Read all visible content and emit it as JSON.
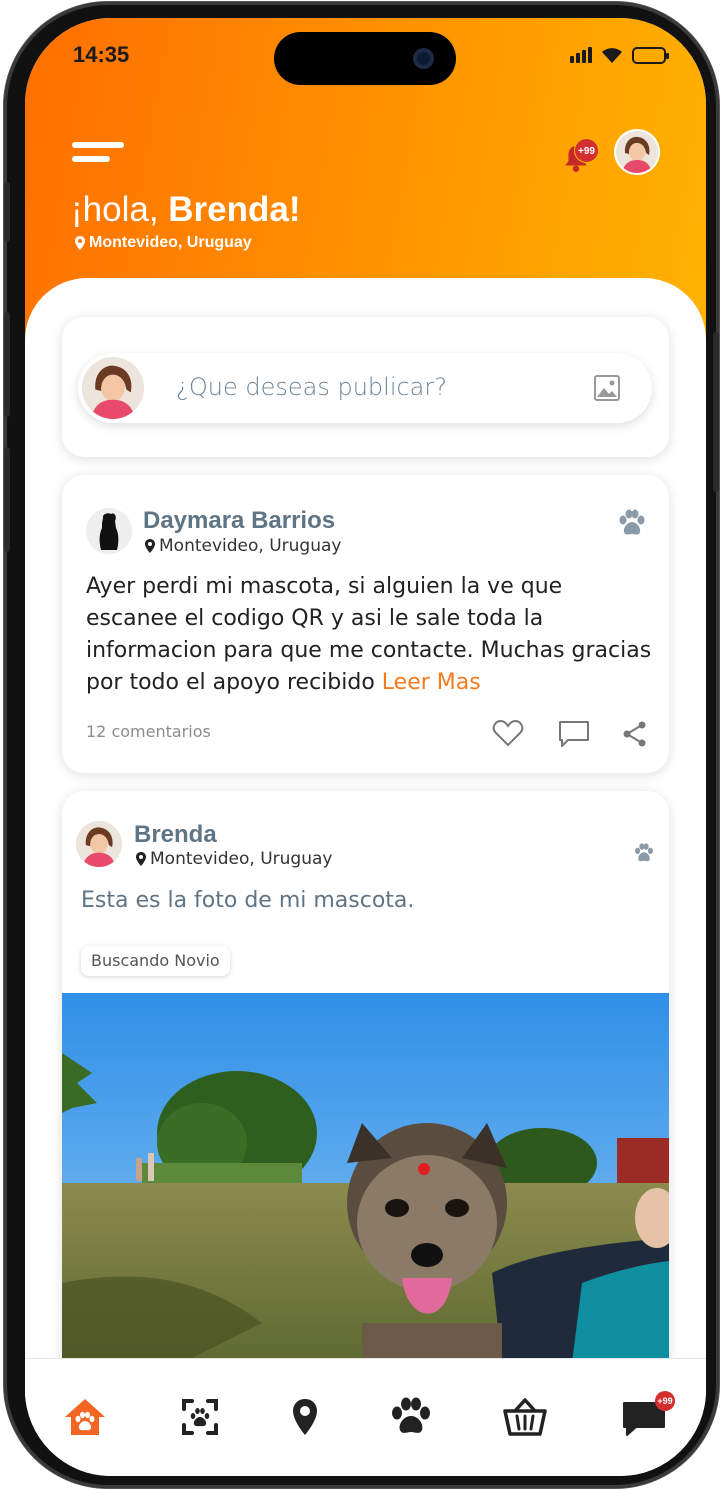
{
  "status_bar": {
    "time": "14:35"
  },
  "header": {
    "greeting_prefix": "¡hola, ",
    "user_name": "Brenda!",
    "location": "Montevideo, Uruguay",
    "notification_badge": "+99"
  },
  "composer": {
    "placeholder": "¿Que deseas publicar?"
  },
  "posts": [
    {
      "author": "Daymara Barrios",
      "location": "Montevideo, Uruguay",
      "text": "Ayer perdi mi mascota, si alguien la ve que escanee el codigo QR y asi le sale toda la informacion para que me contacte. Muchas gracias por todo el apoyo recibido",
      "read_more": "Leer Mas",
      "comments": "12 comentarios"
    },
    {
      "author": "Brenda",
      "location": "Montevideo, Uruguay",
      "text": "Esta es la foto de mi mascota.",
      "tag": "Buscando Novio"
    }
  ],
  "bottom_nav": {
    "items": [
      "home-pet",
      "scan-pet",
      "location",
      "paw",
      "shop-basket",
      "messages"
    ],
    "active": "home-pet",
    "messages_badge": "+99"
  },
  "colors": {
    "accent": "#f47b20",
    "header_gradient_start": "#ff6f00",
    "header_gradient_end": "#ffb300",
    "author_name": "#5f7484",
    "badge": "#d32f2f"
  }
}
